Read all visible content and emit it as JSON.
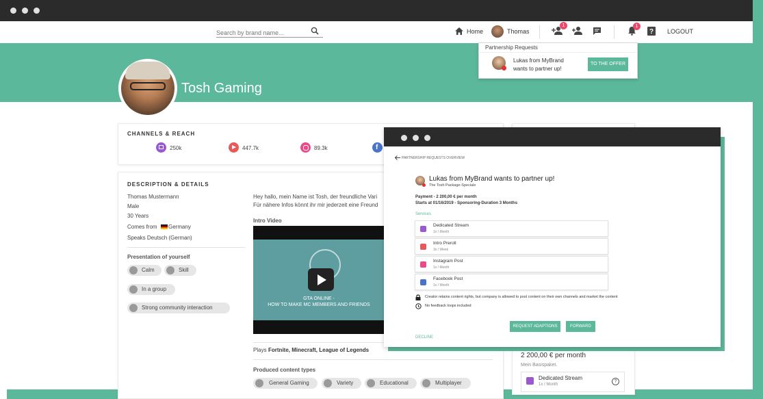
{
  "nav": {
    "search_placeholder": "Search by brand name...",
    "home_label": "Home",
    "user_name": "Thomas",
    "friend_requests_count": "1",
    "notifications_count": "1",
    "logout_label": "LOGOUT"
  },
  "profile": {
    "name": "Tosh Gaming"
  },
  "notification": {
    "title": "Partnership Requests",
    "message_line1": "Lukas from MyBrand",
    "message_line2": "wants to partner up!",
    "button": "TO THE OFFER"
  },
  "channels": {
    "heading": "CHANNELS & REACH",
    "items": [
      {
        "platform": "twitch",
        "value": "250k",
        "color": "#9b59d0"
      },
      {
        "platform": "youtube",
        "value": "447.7k",
        "color": "#e85a5a"
      },
      {
        "platform": "instagram",
        "value": "89.3k",
        "color": "#e84a8a"
      },
      {
        "platform": "facebook",
        "value": "",
        "color": "#4a74c9"
      }
    ]
  },
  "details": {
    "heading": "DESCRIPTION & DETAILS",
    "full_name": "Thomas Mustermann",
    "gender": "Male",
    "age": "30 Years",
    "comes_from_label": "Comes from",
    "country": "Germany",
    "speaks": "Speaks Deutsch (German)",
    "presentation_heading": "Presentation of yourself",
    "traits": [
      "Calm",
      "Skill",
      "In a group",
      "Strong community interaction"
    ]
  },
  "about": {
    "line1": "Hey hallo, mein Name ist Tosh, der freundliche Vari",
    "line2": "Für nähere Infos könnt ihr mir jederzeit eine Freund",
    "intro_video_label": "Intro Video",
    "video_title_line1": "GTA ONLINE -",
    "video_title_line2": "HOW TO MAKE MC MEMBERS AND FRIENDS",
    "plays_label": "Plays",
    "plays_games": "Fortnite, Minecraft, League of Legends",
    "content_types_label": "Produced content types",
    "content_types": [
      "General Gaming",
      "Variety",
      "Educational",
      "Multiplayer"
    ]
  },
  "package": {
    "price": "2 200,00 € per month",
    "name": "Mein Basispaket.",
    "service_name": "Dedicated Stream",
    "service_freq": "1x / Month"
  },
  "overlay": {
    "back_label": "PARTNERSHIP REQUESTS OVERVIEW",
    "title_name": "Lukas from",
    "title_brand": "MyBrand",
    "title_suffix": "wants to partner up!",
    "subtitle": "The Tosh Package-Speciale",
    "payment": "Payment - 2 200,00 € per month",
    "starts": "Starts at 01/16/2019 - Sponsoring-Duration 3 Months",
    "services_label": "Services",
    "services": [
      {
        "name": "Dedicated Stream",
        "freq": "1x / Month",
        "color": "#9b59d0"
      },
      {
        "name": "Intro Preroll",
        "freq": "3x / Week",
        "color": "#e85a5a"
      },
      {
        "name": "Instagram Post",
        "freq": "1x / Month",
        "color": "#e84a8a"
      },
      {
        "name": "Facebook Post",
        "freq": "1x / Month",
        "color": "#4a74c9"
      }
    ],
    "term1": "Creator retains content rights, but company is allowed to post content on their own channels and market the content",
    "term2": "No feedback loops included",
    "request_button": "REQUEST ADAPTIONS",
    "forward_button": "FORWARD",
    "decline_label": "DECLINE"
  }
}
